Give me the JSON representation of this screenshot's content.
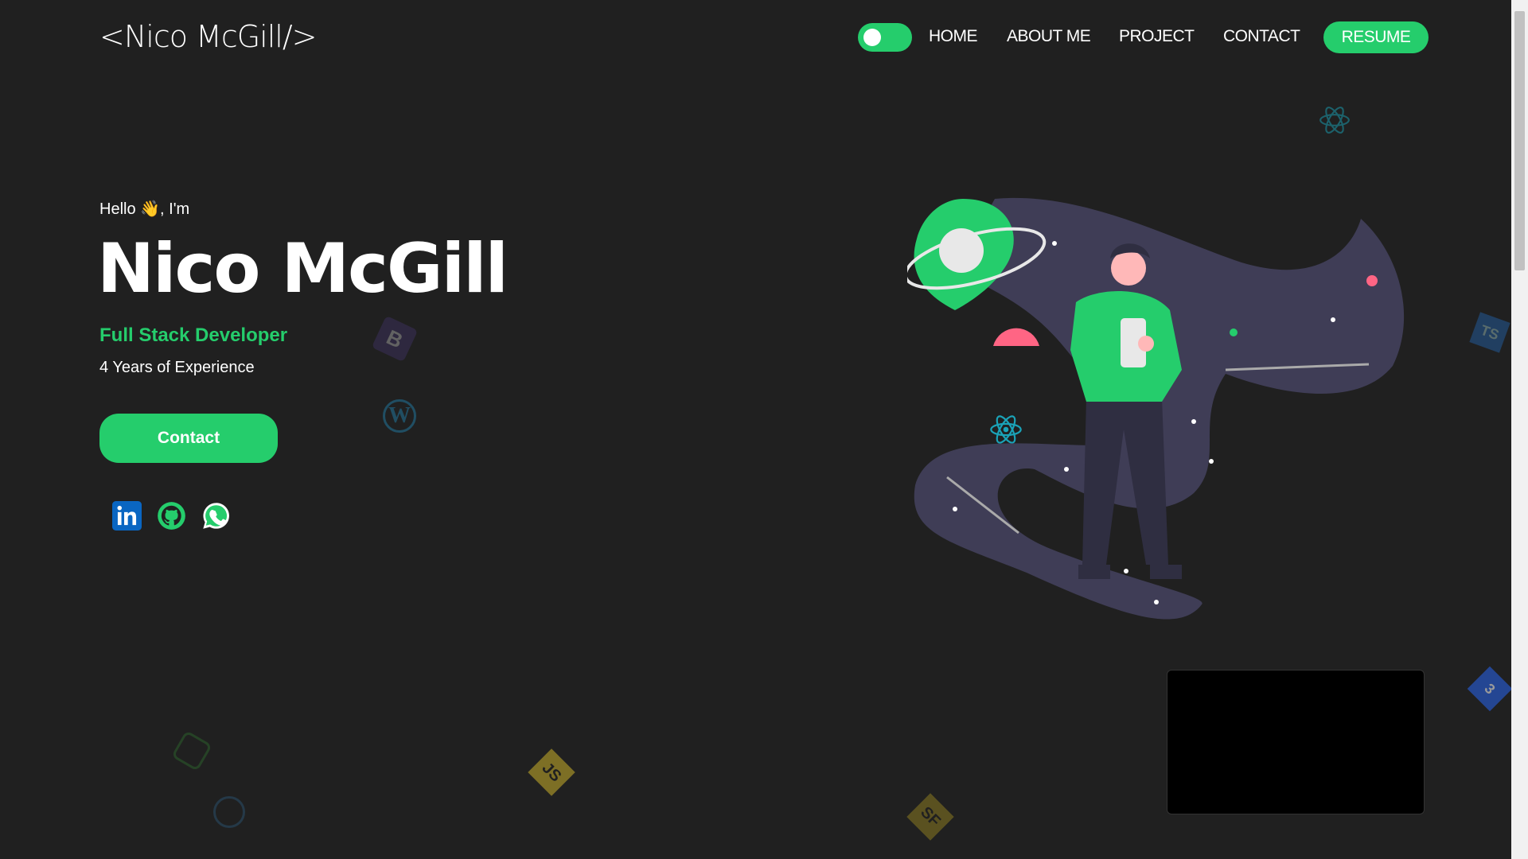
{
  "header": {
    "logo": "<Nico McGill/>",
    "nav": [
      "HOME",
      "ABOUT ME",
      "PROJECT",
      "CONTACT"
    ],
    "resume": "RESUME"
  },
  "hero": {
    "hello": "Hello 👋, I'm",
    "name": "Nico McGill",
    "role": "Full Stack Developer",
    "experience": "4 Years of Experience",
    "contact_label": "Contact"
  },
  "social": [
    "linkedin",
    "github",
    "whatsapp"
  ],
  "colors": {
    "accent": "#25cd6c",
    "background": "#202020",
    "blob": "#3f3d56"
  }
}
